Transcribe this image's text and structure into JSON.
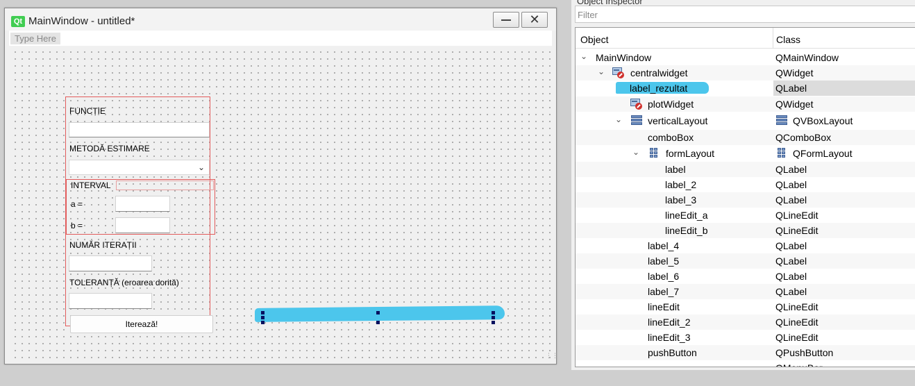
{
  "form_window": {
    "logo_text": "Qt",
    "title": "MainWindow - untitled*",
    "close_glyph": "✕",
    "menubar_placeholder": "Type Here"
  },
  "form": {
    "label_functie": "FUNCȚIE",
    "label_metoda": "METODĂ ESTIMARE",
    "label_interval": "INTERVAL",
    "label_a": "a =",
    "label_b": "b =",
    "label_numar": "NUMĂR ITERAȚII",
    "label_toleranta": "TOLERANȚĂ (eroarea dorită)",
    "button_itereaza": "Iterează!",
    "combobox_icon": "chevron-down-icon"
  },
  "inspector": {
    "title": "Object Inspector",
    "filter_placeholder": "Filter",
    "header_object": "Object",
    "header_class": "Class",
    "rows": [
      {
        "object": "MainWindow",
        "class": "QMainWindow",
        "expander": "⌄",
        "icon": ""
      },
      {
        "object": "centralwidget",
        "class": "QWidget",
        "expander": "⌄",
        "icon": "widget-icon"
      },
      {
        "object": "label_rezultat",
        "class": "QLabel",
        "expander": "",
        "icon": ""
      },
      {
        "object": "plotWidget",
        "class": "QWidget",
        "expander": "",
        "icon": "widget-icon"
      },
      {
        "object": "verticalLayout",
        "class": "QVBoxLayout",
        "expander": "⌄",
        "icon": "vbox-layout-icon"
      },
      {
        "object": "comboBox",
        "class": "QComboBox",
        "expander": "",
        "icon": ""
      },
      {
        "object": "formLayout",
        "class": "QFormLayout",
        "expander": "⌄",
        "icon": "form-layout-icon"
      },
      {
        "object": "label",
        "class": "QLabel",
        "expander": "",
        "icon": ""
      },
      {
        "object": "label_2",
        "class": "QLabel",
        "expander": "",
        "icon": ""
      },
      {
        "object": "label_3",
        "class": "QLabel",
        "expander": "",
        "icon": ""
      },
      {
        "object": "lineEdit_a",
        "class": "QLineEdit",
        "expander": "",
        "icon": ""
      },
      {
        "object": "lineEdit_b",
        "class": "QLineEdit",
        "expander": "",
        "icon": ""
      },
      {
        "object": "label_4",
        "class": "QLabel",
        "expander": "",
        "icon": ""
      },
      {
        "object": "label_5",
        "class": "QLabel",
        "expander": "",
        "icon": ""
      },
      {
        "object": "label_6",
        "class": "QLabel",
        "expander": "",
        "icon": ""
      },
      {
        "object": "label_7",
        "class": "QLabel",
        "expander": "",
        "icon": ""
      },
      {
        "object": "lineEdit",
        "class": "QLineEdit",
        "expander": "",
        "icon": ""
      },
      {
        "object": "lineEdit_2",
        "class": "QLineEdit",
        "expander": "",
        "icon": ""
      },
      {
        "object": "lineEdit_3",
        "class": "QLineEdit",
        "expander": "",
        "icon": ""
      },
      {
        "object": "pushButton",
        "class": "QPushButton",
        "expander": "",
        "icon": ""
      },
      {
        "object": "",
        "class": "QMenuBar",
        "expander": "",
        "icon": ""
      }
    ]
  },
  "colors": {
    "highlight_scribble": "#4cc6ec",
    "layout_border": "#e25b5b",
    "qt_green": "#41cd52"
  }
}
